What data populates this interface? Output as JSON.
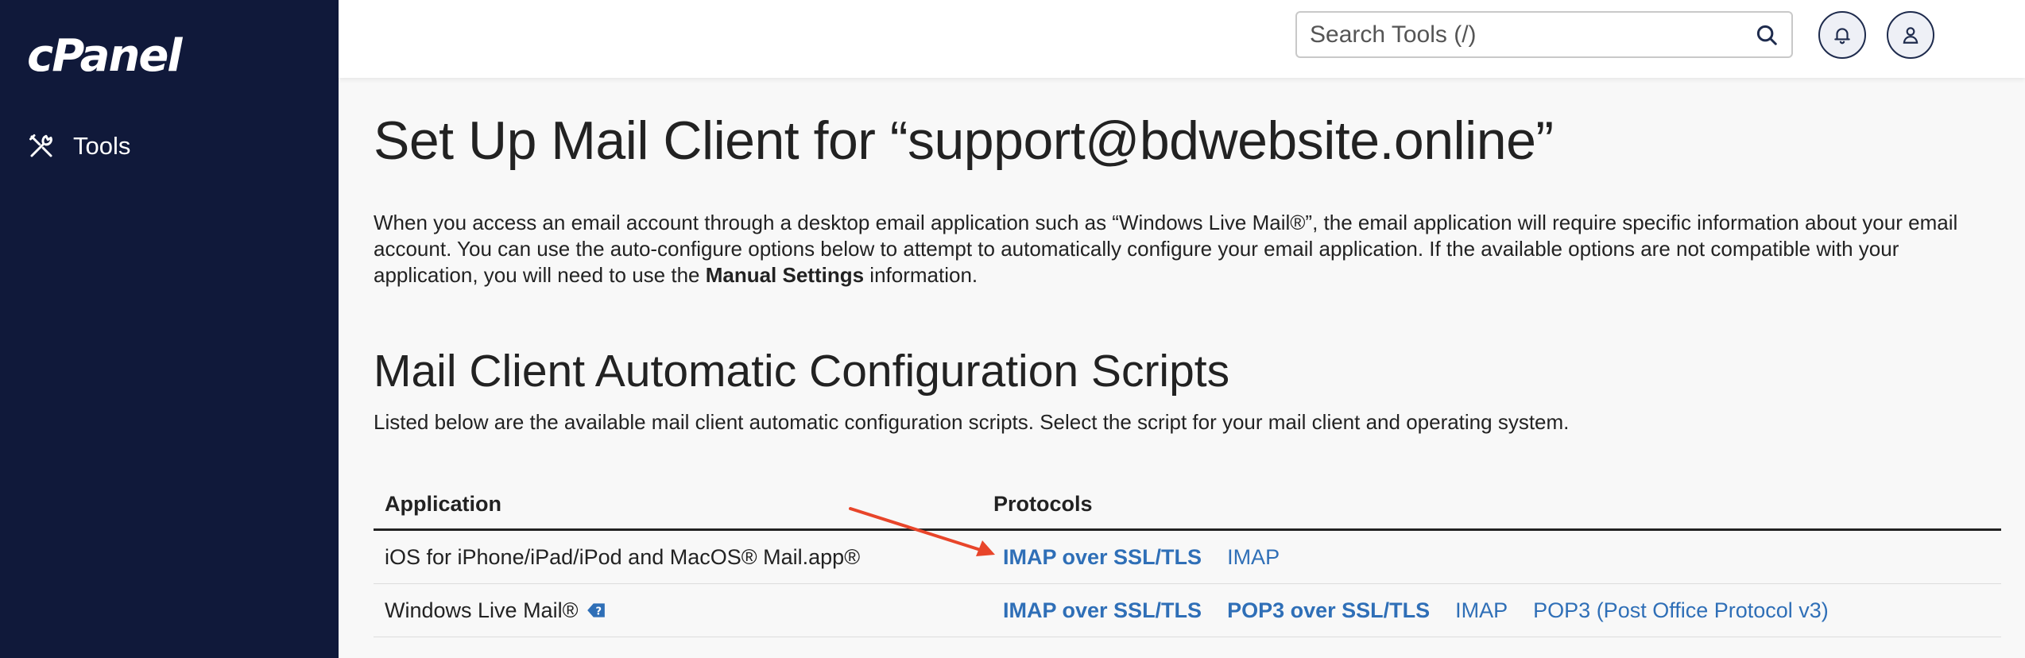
{
  "sidebar": {
    "logo": "cPanel",
    "items": [
      {
        "label": "Tools",
        "icon": "tools-icon"
      }
    ]
  },
  "header": {
    "search": {
      "placeholder": "Search Tools (/)",
      "value": ""
    },
    "notifications_icon": "bell-icon",
    "user_icon": "user-icon"
  },
  "main": {
    "title": "Set Up Mail Client for “support@bdwebsite.online”",
    "intro": {
      "part1": "When you access an email account through a desktop email application such as “Windows Live Mail®”, the email application will require specific information about your email account. You can use the auto-configure options below to attempt to automatically configure your email application. If the available options are not compatible with your application, you will need to use the ",
      "bold": "Manual Settings",
      "part2": " information."
    },
    "section": {
      "title": "Mail Client Automatic Configuration Scripts",
      "description": "Listed below are the available mail client automatic configuration scripts. Select the script for your mail client and operating system."
    },
    "table": {
      "headers": {
        "application": "Application",
        "protocols": "Protocols"
      },
      "rows": [
        {
          "application": "iOS for iPhone/iPad/iPod and MacOS® Mail.app®",
          "protocols": [
            {
              "label": "IMAP over SSL/TLS",
              "bold": true
            },
            {
              "label": "IMAP",
              "bold": false
            }
          ]
        },
        {
          "application": "Windows Live Mail®",
          "has_help_icon": true,
          "protocols": [
            {
              "label": "IMAP over SSL/TLS",
              "bold": true
            },
            {
              "label": "POP3 over SSL/TLS",
              "bold": true
            },
            {
              "label": "IMAP",
              "bold": false
            },
            {
              "label": "POP3 (Post Office Protocol v3)",
              "bold": false
            }
          ]
        }
      ]
    }
  },
  "colors": {
    "sidebar_bg": "#10193a",
    "link": "#2f6fb7",
    "annotation_arrow": "#e8452a",
    "page_bg": "#f8f8f8"
  }
}
